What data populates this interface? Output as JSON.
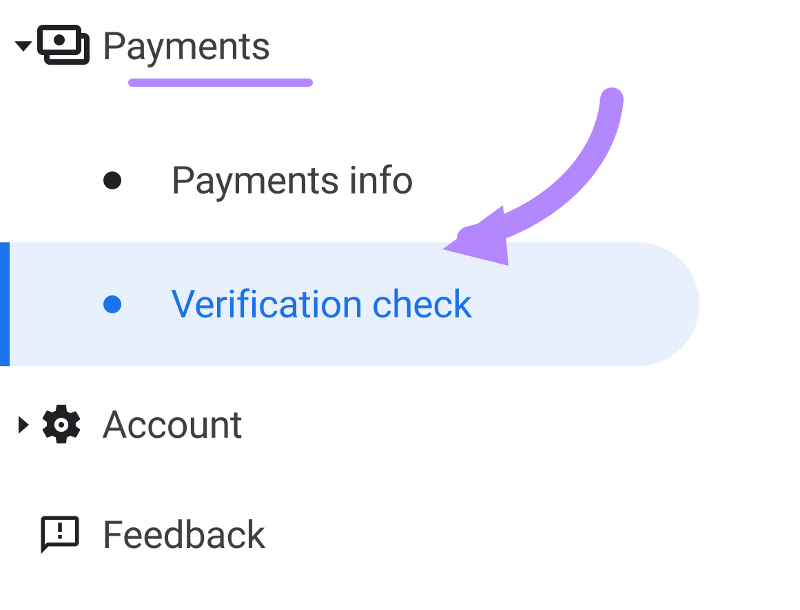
{
  "colors": {
    "text": "#3c4043",
    "icon": "#202124",
    "primary": "#1a73e8",
    "primary_bg": "#e8f0fe",
    "annotation": "#b388ff"
  },
  "nav": {
    "payments": {
      "label": "Payments",
      "expanded": true,
      "items": [
        {
          "label": "Payments info",
          "selected": false
        },
        {
          "label": "Verification check",
          "selected": true
        }
      ]
    },
    "account": {
      "label": "Account",
      "expanded": false
    },
    "feedback": {
      "label": "Feedback"
    }
  }
}
